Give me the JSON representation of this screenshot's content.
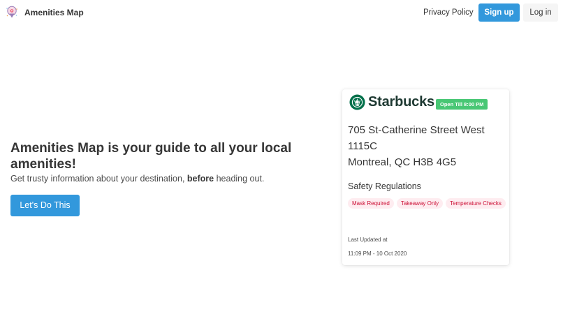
{
  "nav": {
    "brand": "Amenities Map",
    "privacy_label": "Privacy Policy",
    "signup_label": "Sign up",
    "login_label": "Log in"
  },
  "hero": {
    "title": "Amenities Map is your guide to all your local amenities!",
    "subtitle_before": "Get trusty information about your destination, ",
    "subtitle_bold": "before",
    "subtitle_after": " heading out.",
    "cta_label": "Let's Do This"
  },
  "card": {
    "name": "Starbucks",
    "status": "Open Till 8:00 PM",
    "address_line1": "705 St-Catherine Street West",
    "address_line2": "1115C",
    "address_line3": "Montreal, QC H3B 4G5",
    "safety_title": "Safety Regulations",
    "tags": [
      "Mask Required",
      "Takeaway Only",
      "Temperature Checks"
    ],
    "updated_label": "Last Updated at",
    "updated_value": "11:09 PM - 10 Oct 2020"
  },
  "colors": {
    "primary": "#3298dc",
    "success": "#48c774",
    "tag_bg": "#feecf0",
    "tag_text": "#cc0f35",
    "starbucks_green": "#00704a"
  },
  "icons": {
    "brand": "map-pin-icon",
    "card_logo": "starbucks-logo-icon"
  }
}
